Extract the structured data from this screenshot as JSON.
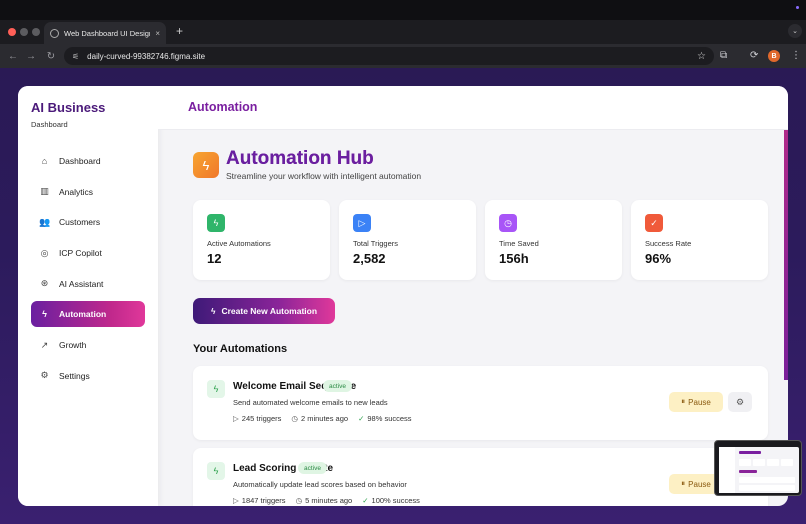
{
  "browser": {
    "tab_title": "Web Dashboard UI Design",
    "tab_close": "×",
    "new_tab": "+",
    "url": "daily-curved-99382746.figma.site",
    "avatar_letter": "B",
    "icons": [
      "back-icon",
      "forward-icon",
      "reload-icon",
      "tune-icon",
      "star-icon",
      "extensions-icon",
      "sync-icon",
      "kebab-menu-icon"
    ]
  },
  "sidebar": {
    "brand_title": "AI Business",
    "brand_sub": "Dashboard",
    "items": [
      {
        "label": "Dashboard",
        "icon": "home-icon",
        "glyph": "⌂",
        "active": false
      },
      {
        "label": "Analytics",
        "icon": "bar-chart-icon",
        "glyph": "▥",
        "active": false
      },
      {
        "label": "Customers",
        "icon": "users-icon",
        "glyph": "👥",
        "active": false
      },
      {
        "label": "ICP Copilot",
        "icon": "target-icon",
        "glyph": "◎",
        "active": false
      },
      {
        "label": "AI Assistant",
        "icon": "brain-icon",
        "glyph": "⊛",
        "active": false
      },
      {
        "label": "Automation",
        "icon": "bolt-icon",
        "glyph": "ϟ",
        "active": true
      },
      {
        "label": "Growth",
        "icon": "trending-up-icon",
        "glyph": "↗",
        "active": false
      },
      {
        "label": "Settings",
        "icon": "gear-icon",
        "glyph": "⚙",
        "active": false
      }
    ]
  },
  "header": {
    "title": "Automation"
  },
  "hub": {
    "title": "Automation Hub",
    "subtitle": "Streamline your workflow with intelligent automation"
  },
  "stats": [
    {
      "label": "Active Automations",
      "value": "12",
      "icon": "bolt-icon",
      "glyph": "ϟ",
      "color": "#2fb56a"
    },
    {
      "label": "Total Triggers",
      "value": "2,582",
      "icon": "play-icon",
      "glyph": "▷",
      "color": "#3b82f6"
    },
    {
      "label": "Time Saved",
      "value": "156h",
      "icon": "clock-icon",
      "glyph": "◷",
      "color": "#a855f7"
    },
    {
      "label": "Success Rate",
      "value": "96%",
      "icon": "check-circle-icon",
      "glyph": "✓",
      "color": "#f05a3a"
    }
  ],
  "create_button": "Create New Automation",
  "section_title": "Your Automations",
  "automations": [
    {
      "name": "Welcome Email Sequence",
      "status": "active",
      "description": "Send automated welcome emails to new leads",
      "triggers": "245 triggers",
      "last_run": "2 minutes ago",
      "success": "98% success",
      "pause_label": "Pause"
    },
    {
      "name": "Lead Scoring Update",
      "status": "active",
      "description": "Automatically update lead scores based on behavior",
      "triggers": "1847 triggers",
      "last_run": "5 minutes ago",
      "success": "100% success",
      "pause_label": "Pause"
    }
  ],
  "colors": {
    "brand_purple": "#4b1a7a",
    "accent_gradient_start": "#6a1fa0",
    "accent_gradient_end": "#e0389a",
    "page_bg": "#2a1a55",
    "success_green": "#2aa04a"
  }
}
